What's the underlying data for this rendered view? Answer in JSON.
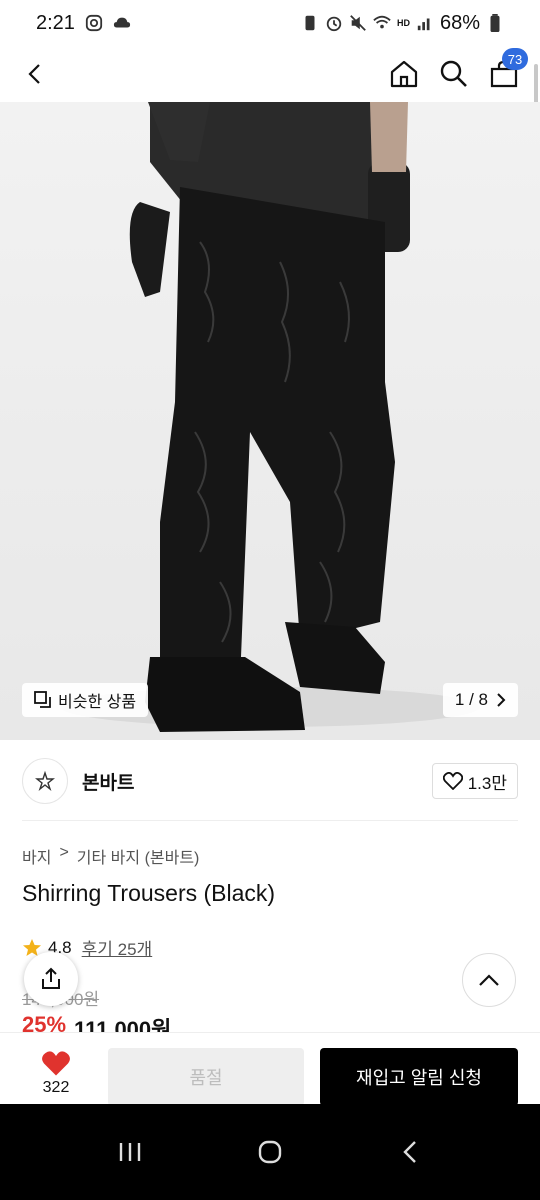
{
  "status": {
    "time": "2:21",
    "battery": "68%",
    "hd_label": "HD"
  },
  "header": {
    "back_icon": "chevron-left-icon",
    "home_icon": "home-icon",
    "search_icon": "search-icon",
    "cart_icon": "cart-icon",
    "cart_count": "73",
    "accent": "#2f6bde"
  },
  "image": {
    "similar_label": "비슷한 상품",
    "counter": "1 / 8"
  },
  "brand": {
    "name": "본바트",
    "likes": "1.3만"
  },
  "product": {
    "breadcrumb": [
      "바지",
      "기타 바지 (본바트)"
    ],
    "title": "Shirring Trousers (Black)",
    "rating": "4.8",
    "reviews": "후기 25개",
    "original_price": "148,000원",
    "discount": "25%",
    "sale_price": "111,000원",
    "discount_color": "#e0332e"
  },
  "cta": {
    "wish_count": "322",
    "soldout_label": "품절",
    "restock_label": "재입고 알림 신청"
  }
}
